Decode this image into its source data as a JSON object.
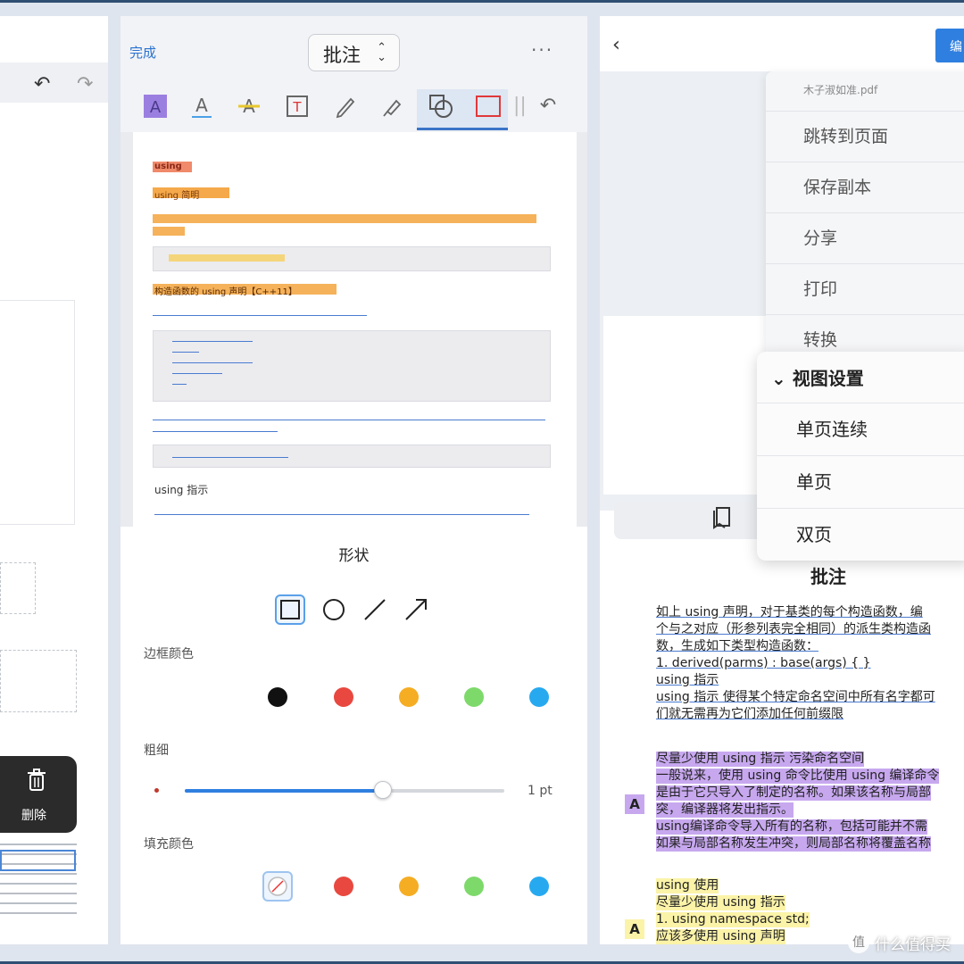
{
  "left_panel": {
    "undo_icon": "undo-icon",
    "redo_icon": "redo-icon",
    "popup": {
      "icon": "trash-icon",
      "label": "删除"
    }
  },
  "mid_panel": {
    "done_label": "完成",
    "mode_label": "批注",
    "more_label": "···",
    "tools": [
      "highlight-box-icon",
      "text-underline-icon",
      "strikethrough-icon",
      "text-box-icon",
      "pencil-icon",
      "marker-icon",
      "shapes-icon",
      "rectangle-icon",
      "undo-icon"
    ],
    "doc": {
      "h1": "using",
      "h2": "using 简明",
      "h3": "构造函数的 using 声明【C++11】",
      "h4": "using 指示"
    },
    "shape_title": "形状",
    "shapes": [
      "square-icon",
      "circle-icon",
      "line-icon",
      "arrow-icon"
    ],
    "border_color_label": "边框颜色",
    "border_colors": [
      "#111111",
      "#e8483f",
      "#f5ad24",
      "#7ed96b",
      "#27a9f0",
      "#a88ee8",
      "color-wheel"
    ],
    "thickness_label": "粗细",
    "thickness_value": "1 pt",
    "thickness_fraction": 0.62,
    "fill_color_label": "填充颜色",
    "fill_colors": [
      "none",
      "#e8483f",
      "#f5ad24",
      "#7ed96b",
      "#27a9f0",
      "#a88ee8",
      "color-wheel"
    ]
  },
  "right_panel": {
    "back_icon": "chevron-left-icon",
    "corner_button": "编",
    "menu": {
      "file_name": "木子淑如准.pdf",
      "items": [
        "跳转到页面",
        "保存副本",
        "分享",
        "打印",
        "转换"
      ]
    },
    "submenu": {
      "header": "视图设置",
      "items": [
        "单页连续",
        "单页",
        "双页"
      ]
    },
    "bookmark_icon": "bookmark-icon",
    "annot_title": "批注",
    "annot_lines_1": [
      "如上 using 声明，对于基类的每个构造函数，编",
      "个与之对应（形参列表完全相同）的派生类构造函",
      "数，生成如下类型构造函数：",
      "1. derived(parms) : base(args) { }",
      "using 指示",
      "using 指示 使得某个特定命名空间中所有名字都可",
      "们就无需再为它们添加任何前缀限"
    ],
    "annot_lines_2": [
      "尽量少使用 using 指示 污染命名空间",
      "一般说来，使用 using 命令比使用 using 编译命令",
      "是由于它只导入了制定的名称。如果该名称与局部",
      "突，编译器将发出指示。",
      "using编译命令导入所有的名称，包括可能并不需",
      "如果与局部名称发生冲突，则局部名称将覆盖名称"
    ],
    "annot_lines_3": [
      "using 使用",
      "尽量少使用 using 指示",
      "1. using namespace std;",
      "应该多使用 using 声明"
    ],
    "marker_label": "A"
  },
  "watermark": "什么值得买"
}
